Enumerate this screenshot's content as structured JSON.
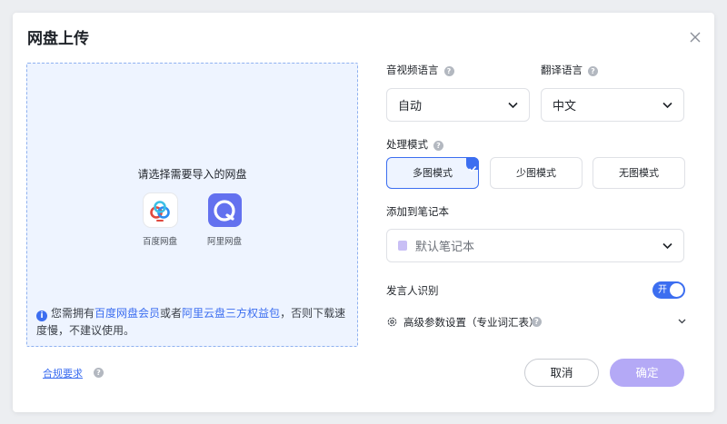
{
  "dialog": {
    "title": "网盘上传",
    "close_icon": "close-icon"
  },
  "upload": {
    "prompt": "请选择需要导入的网盘",
    "providers": [
      {
        "label": "百度网盘",
        "icon": "baidu-netdisk-logo"
      },
      {
        "label": "阿里网盘",
        "icon": "aliyun-drive-logo"
      }
    ],
    "notice": {
      "icon": "info-icon",
      "prefix": "您需拥有",
      "link1": "百度网盘会员",
      "middle": "或者",
      "link2": "阿里云盘三方权益包",
      "suffix": "，否则下载速度慢，不建议使用。"
    }
  },
  "form": {
    "audio_lang": {
      "label": "音视频语言",
      "value": "自动"
    },
    "translate_lang": {
      "label": "翻译语言",
      "value": "中文"
    },
    "process_mode": {
      "label": "处理模式",
      "options": [
        "多图模式",
        "少图模式",
        "无图模式"
      ],
      "selected": "多图模式"
    },
    "notebook": {
      "label": "添加到笔记本",
      "value": "默认笔记本"
    },
    "speaker": {
      "label": "发言人识别",
      "toggle_label": "开",
      "enabled": true
    },
    "advanced": {
      "label": "高级参数设置（专业词汇表）"
    }
  },
  "footer": {
    "compliance": "合规要求",
    "cancel": "取消",
    "confirm": "确定"
  },
  "colors": {
    "accent": "#3c6ef0",
    "confirm_disabled": "#b4a9f6",
    "dropzone_bg": "#eef4ff"
  }
}
